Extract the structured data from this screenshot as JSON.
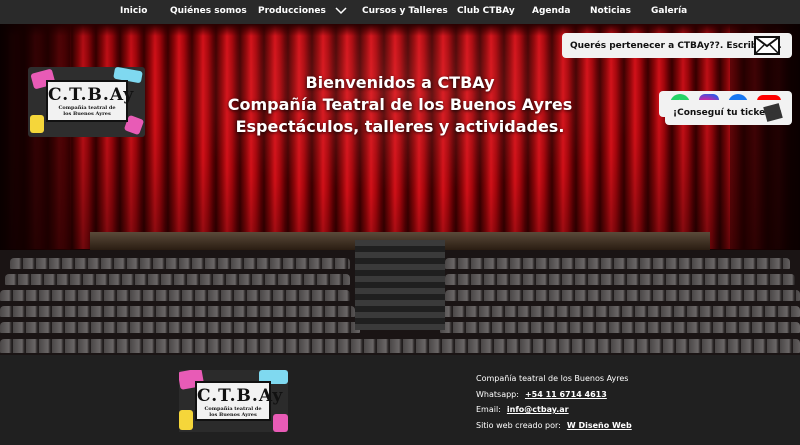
{
  "nav": {
    "items": [
      {
        "label": "Inicio"
      },
      {
        "label": "Quiénes somos"
      },
      {
        "label": "Producciones"
      },
      {
        "label": "Cursos y Talleres"
      },
      {
        "label": "Club CTBAy"
      },
      {
        "label": "Agenda"
      },
      {
        "label": "Noticias"
      },
      {
        "label": "Galería"
      }
    ]
  },
  "hero": {
    "line1": "Bienvenidos a CTBAy",
    "line2": "Compañía Teatral de los Buenos Ayres",
    "line3": "Espectáculos, talleres y actividades."
  },
  "logo": {
    "big": "C.T.B.Ay",
    "small1": "Compañía teatral de",
    "small2": "los Buenos Ayres"
  },
  "widgets": {
    "join": "Querés pertenecer a CTBAy??. Escribinos.",
    "ticket": "¡Conseguí tu ticket!",
    "social": [
      "whatsapp-icon",
      "instagram-icon",
      "facebook-icon",
      "youtube-icon"
    ]
  },
  "footer": {
    "company": "Compañía teatral de los Buenos Ayres",
    "whatsapp_label": "Whatsapp:",
    "whatsapp_value": "+54 11 6714 4613",
    "email_label": "Email:",
    "email_value": "info@ctbay.ar",
    "credit_label": "Sitio web creado por:",
    "credit_value": "W Diseño Web"
  },
  "colors": {
    "nav_bg": "#2a2a2a",
    "curtain": "#c4121a",
    "footer_bg": "#202020",
    "whatsapp": "#25d366",
    "facebook": "#1877f2",
    "youtube": "#ff0000"
  }
}
